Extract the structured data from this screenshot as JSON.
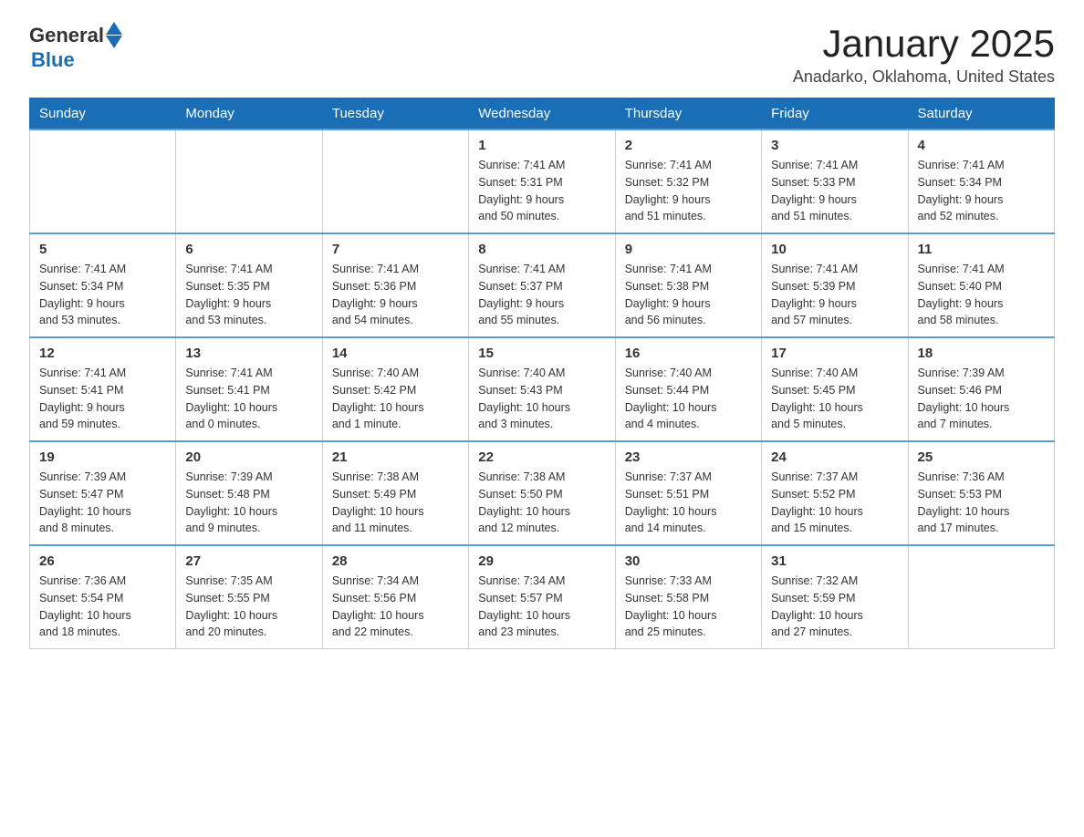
{
  "header": {
    "logo_general": "General",
    "logo_blue": "Blue",
    "month_title": "January 2025",
    "location": "Anadarko, Oklahoma, United States"
  },
  "days_of_week": [
    "Sunday",
    "Monday",
    "Tuesday",
    "Wednesday",
    "Thursday",
    "Friday",
    "Saturday"
  ],
  "weeks": [
    [
      {
        "day": "",
        "info": ""
      },
      {
        "day": "",
        "info": ""
      },
      {
        "day": "",
        "info": ""
      },
      {
        "day": "1",
        "info": "Sunrise: 7:41 AM\nSunset: 5:31 PM\nDaylight: 9 hours\nand 50 minutes."
      },
      {
        "day": "2",
        "info": "Sunrise: 7:41 AM\nSunset: 5:32 PM\nDaylight: 9 hours\nand 51 minutes."
      },
      {
        "day": "3",
        "info": "Sunrise: 7:41 AM\nSunset: 5:33 PM\nDaylight: 9 hours\nand 51 minutes."
      },
      {
        "day": "4",
        "info": "Sunrise: 7:41 AM\nSunset: 5:34 PM\nDaylight: 9 hours\nand 52 minutes."
      }
    ],
    [
      {
        "day": "5",
        "info": "Sunrise: 7:41 AM\nSunset: 5:34 PM\nDaylight: 9 hours\nand 53 minutes."
      },
      {
        "day": "6",
        "info": "Sunrise: 7:41 AM\nSunset: 5:35 PM\nDaylight: 9 hours\nand 53 minutes."
      },
      {
        "day": "7",
        "info": "Sunrise: 7:41 AM\nSunset: 5:36 PM\nDaylight: 9 hours\nand 54 minutes."
      },
      {
        "day": "8",
        "info": "Sunrise: 7:41 AM\nSunset: 5:37 PM\nDaylight: 9 hours\nand 55 minutes."
      },
      {
        "day": "9",
        "info": "Sunrise: 7:41 AM\nSunset: 5:38 PM\nDaylight: 9 hours\nand 56 minutes."
      },
      {
        "day": "10",
        "info": "Sunrise: 7:41 AM\nSunset: 5:39 PM\nDaylight: 9 hours\nand 57 minutes."
      },
      {
        "day": "11",
        "info": "Sunrise: 7:41 AM\nSunset: 5:40 PM\nDaylight: 9 hours\nand 58 minutes."
      }
    ],
    [
      {
        "day": "12",
        "info": "Sunrise: 7:41 AM\nSunset: 5:41 PM\nDaylight: 9 hours\nand 59 minutes."
      },
      {
        "day": "13",
        "info": "Sunrise: 7:41 AM\nSunset: 5:41 PM\nDaylight: 10 hours\nand 0 minutes."
      },
      {
        "day": "14",
        "info": "Sunrise: 7:40 AM\nSunset: 5:42 PM\nDaylight: 10 hours\nand 1 minute."
      },
      {
        "day": "15",
        "info": "Sunrise: 7:40 AM\nSunset: 5:43 PM\nDaylight: 10 hours\nand 3 minutes."
      },
      {
        "day": "16",
        "info": "Sunrise: 7:40 AM\nSunset: 5:44 PM\nDaylight: 10 hours\nand 4 minutes."
      },
      {
        "day": "17",
        "info": "Sunrise: 7:40 AM\nSunset: 5:45 PM\nDaylight: 10 hours\nand 5 minutes."
      },
      {
        "day": "18",
        "info": "Sunrise: 7:39 AM\nSunset: 5:46 PM\nDaylight: 10 hours\nand 7 minutes."
      }
    ],
    [
      {
        "day": "19",
        "info": "Sunrise: 7:39 AM\nSunset: 5:47 PM\nDaylight: 10 hours\nand 8 minutes."
      },
      {
        "day": "20",
        "info": "Sunrise: 7:39 AM\nSunset: 5:48 PM\nDaylight: 10 hours\nand 9 minutes."
      },
      {
        "day": "21",
        "info": "Sunrise: 7:38 AM\nSunset: 5:49 PM\nDaylight: 10 hours\nand 11 minutes."
      },
      {
        "day": "22",
        "info": "Sunrise: 7:38 AM\nSunset: 5:50 PM\nDaylight: 10 hours\nand 12 minutes."
      },
      {
        "day": "23",
        "info": "Sunrise: 7:37 AM\nSunset: 5:51 PM\nDaylight: 10 hours\nand 14 minutes."
      },
      {
        "day": "24",
        "info": "Sunrise: 7:37 AM\nSunset: 5:52 PM\nDaylight: 10 hours\nand 15 minutes."
      },
      {
        "day": "25",
        "info": "Sunrise: 7:36 AM\nSunset: 5:53 PM\nDaylight: 10 hours\nand 17 minutes."
      }
    ],
    [
      {
        "day": "26",
        "info": "Sunrise: 7:36 AM\nSunset: 5:54 PM\nDaylight: 10 hours\nand 18 minutes."
      },
      {
        "day": "27",
        "info": "Sunrise: 7:35 AM\nSunset: 5:55 PM\nDaylight: 10 hours\nand 20 minutes."
      },
      {
        "day": "28",
        "info": "Sunrise: 7:34 AM\nSunset: 5:56 PM\nDaylight: 10 hours\nand 22 minutes."
      },
      {
        "day": "29",
        "info": "Sunrise: 7:34 AM\nSunset: 5:57 PM\nDaylight: 10 hours\nand 23 minutes."
      },
      {
        "day": "30",
        "info": "Sunrise: 7:33 AM\nSunset: 5:58 PM\nDaylight: 10 hours\nand 25 minutes."
      },
      {
        "day": "31",
        "info": "Sunrise: 7:32 AM\nSunset: 5:59 PM\nDaylight: 10 hours\nand 27 minutes."
      },
      {
        "day": "",
        "info": ""
      }
    ]
  ]
}
